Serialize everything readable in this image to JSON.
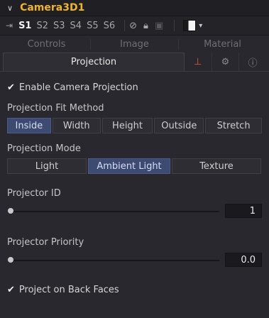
{
  "header": {
    "title": "Camera3D1"
  },
  "versions": {
    "items": [
      "S1",
      "S2",
      "S3",
      "S4",
      "S5",
      "S6"
    ],
    "active": "S1"
  },
  "tabs": {
    "top": [
      "Controls",
      "Image",
      "Material"
    ],
    "active": "Projection"
  },
  "enable_projection": {
    "label": "Enable Camera Projection",
    "checked": true
  },
  "fit_method": {
    "label": "Projection Fit Method",
    "options": [
      "Inside",
      "Width",
      "Height",
      "Outside",
      "Stretch"
    ],
    "selected": "Inside"
  },
  "projection_mode": {
    "label": "Projection Mode",
    "options": [
      "Light",
      "Ambient Light",
      "Texture"
    ],
    "selected": "Ambient Light"
  },
  "projector_id": {
    "label": "Projector ID",
    "value": "1"
  },
  "projector_priority": {
    "label": "Projector Priority",
    "value": "0.0"
  },
  "back_faces": {
    "label": "Project on Back Faces",
    "checked": true
  },
  "colors": {
    "title": "#f0b429",
    "active_button": "#3d4a72",
    "panel_bg": "#28282e"
  }
}
